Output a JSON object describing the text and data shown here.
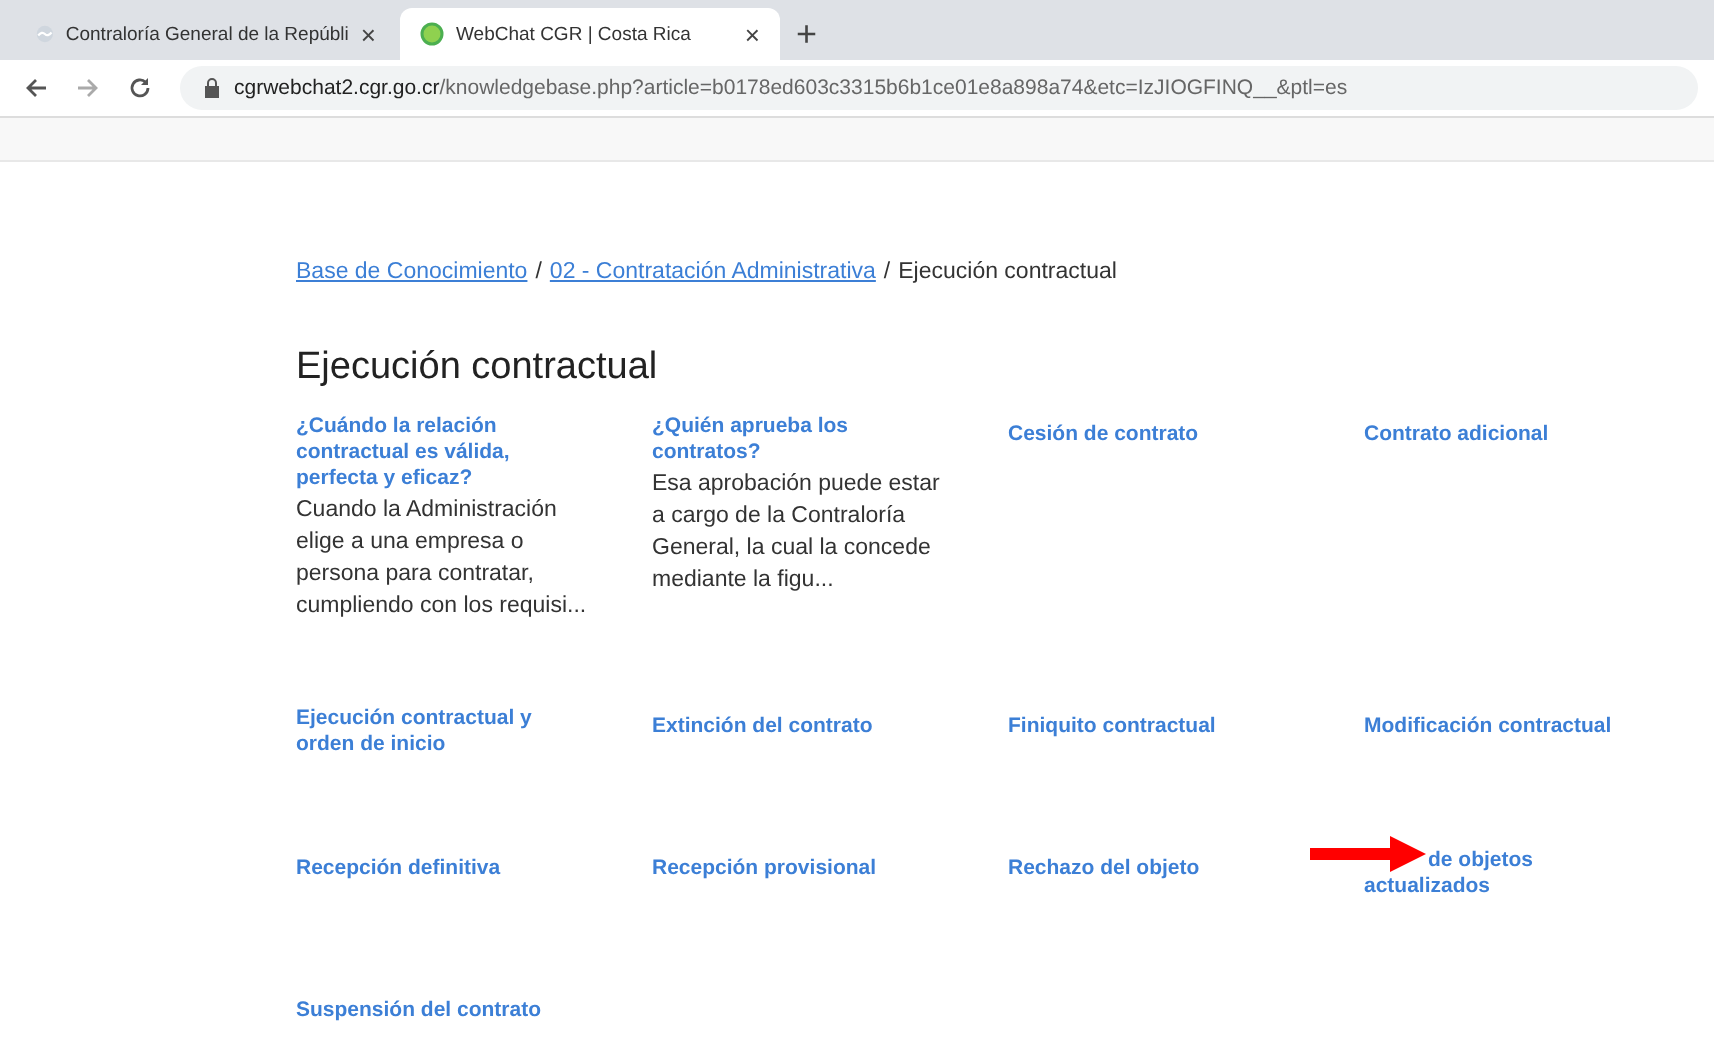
{
  "browser": {
    "tabs": [
      {
        "title": "Contraloría General de la Repúbli",
        "close": "×",
        "selected": false
      },
      {
        "title": "WebChat CGR | Costa Rica",
        "close": "×",
        "selected": true
      }
    ],
    "new_tab": "+",
    "url_host": "cgrwebchat2.cgr.go.cr",
    "url_path": "/knowledgebase.php?article=b0178ed603c3315b6b1ce01e8a898a74&etc=IzJIOGFINQ__&ptl=es"
  },
  "breadcrumb": {
    "links": [
      "Base de Conocimiento",
      "02 - Contratación Administrativa"
    ],
    "separator": "/",
    "current": "Ejecución contractual"
  },
  "heading": "Ejecución contractual",
  "articles": [
    {
      "title": "¿Cuándo la relación contractual es válida, perfecta y eficaz?",
      "excerpt": "Cuando la Administración elige a una empresa o persona para contratar, cumpliendo con los requisi..."
    },
    {
      "title": "¿Quién aprueba los contratos?",
      "excerpt": "Esa aprobación puede estar a cargo de la Contraloría General, la cual la concede mediante la figu..."
    },
    {
      "title": "Cesión de contrato"
    },
    {
      "title": "Contrato adicional"
    },
    {
      "title": "Ejecución contractual y orden de inicio"
    },
    {
      "title": "Extinción del contrato"
    },
    {
      "title": "Finiquito contractual"
    },
    {
      "title": "Modificación contractual"
    },
    {
      "title": "Recepción definitiva"
    },
    {
      "title": "Recepción provisional"
    },
    {
      "title": "Rechazo del objeto"
    },
    {
      "title": "de objetos actualizados",
      "arrow": true
    },
    {
      "title": "Suspensión del contrato"
    }
  ]
}
